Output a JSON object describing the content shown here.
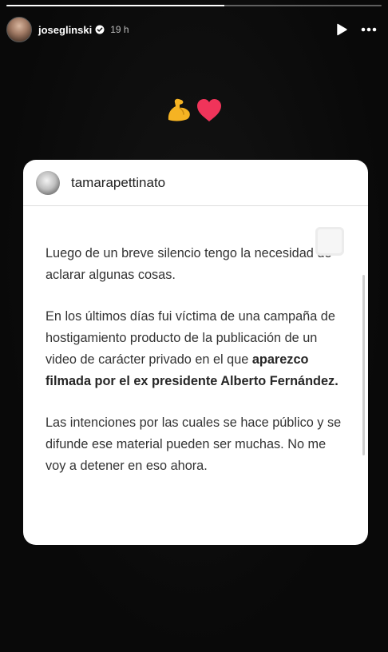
{
  "story": {
    "progress": 0.58,
    "username": "joseglinski",
    "time": "19 h",
    "verified": true,
    "emojis": [
      "flexed-biceps",
      "red-heart"
    ]
  },
  "post": {
    "username": "tamarapettinato",
    "paragraph1": "Luego de un breve silencio tengo la necesidad de aclarar algunas cosas.",
    "paragraph2_start": "En los últimos días fui víctima de una campaña de hostigamiento producto de la publicación de un video de carácter privado en el que ",
    "paragraph2_bold": "aparezco filmada por el ex presidente Alberto Fernández.",
    "paragraph3": "Las intenciones por las cuales se hace público y se difunde ese material pueden ser muchas. No me voy a detener en eso ahora."
  },
  "colors": {
    "background": "#0b0b0b",
    "card": "#ffffff",
    "heart": "#f0345a",
    "biceps": "#f5b323"
  }
}
